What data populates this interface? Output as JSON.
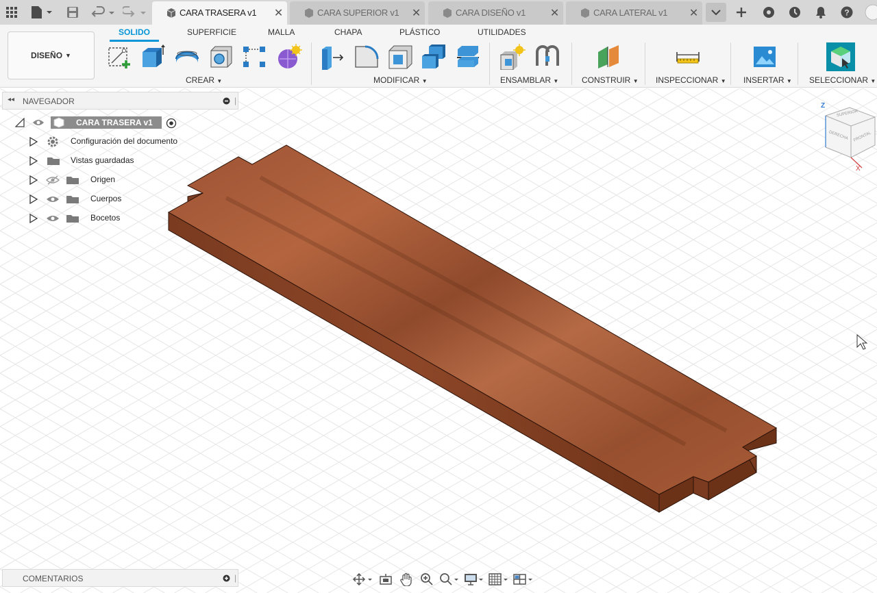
{
  "tabs": [
    {
      "label": "CARA TRASERA v1",
      "active": true
    },
    {
      "label": "CARA SUPERIOR v1",
      "active": false
    },
    {
      "label": "CARA DISEÑO v1",
      "active": false
    },
    {
      "label": "CARA LATERAL v1",
      "active": false
    }
  ],
  "ribbon": {
    "workspace_label": "DISEÑO",
    "tabs": [
      "SOLIDO",
      "SUPERFICIE",
      "MALLA",
      "CHAPA",
      "PLÁSTICO",
      "UTILIDADES"
    ],
    "groups": [
      "CREAR",
      "MODIFICAR",
      "ENSAMBLAR",
      "CONSTRUIR",
      "INSPECCIONAR",
      "INSERTAR",
      "SELECCIONAR"
    ]
  },
  "browser": {
    "title": "NAVEGADOR",
    "root": "CARA TRASERA v1",
    "items": [
      {
        "label": "Configuración del documento",
        "icon": "gear-icon"
      },
      {
        "label": "Vistas guardadas",
        "icon": "folder-icon"
      },
      {
        "label": "Origen",
        "icon": "folder-icon",
        "visibility": "hidden"
      },
      {
        "label": "Cuerpos",
        "icon": "folder-icon",
        "visibility": "visible"
      },
      {
        "label": "Bocetos",
        "icon": "folder-icon",
        "visibility": "visible"
      }
    ]
  },
  "comments": {
    "title": "COMENTARIOS"
  },
  "viewcube": {
    "axis_z": "Z",
    "axis_x": "X",
    "face_top": "SUPERIOR",
    "face_front": "DERECHA",
    "face_right": "FRONTAL"
  },
  "colors": {
    "accent": "#0696d7",
    "wood": "#a8593a",
    "tab_bar": "#d7d7d7"
  }
}
